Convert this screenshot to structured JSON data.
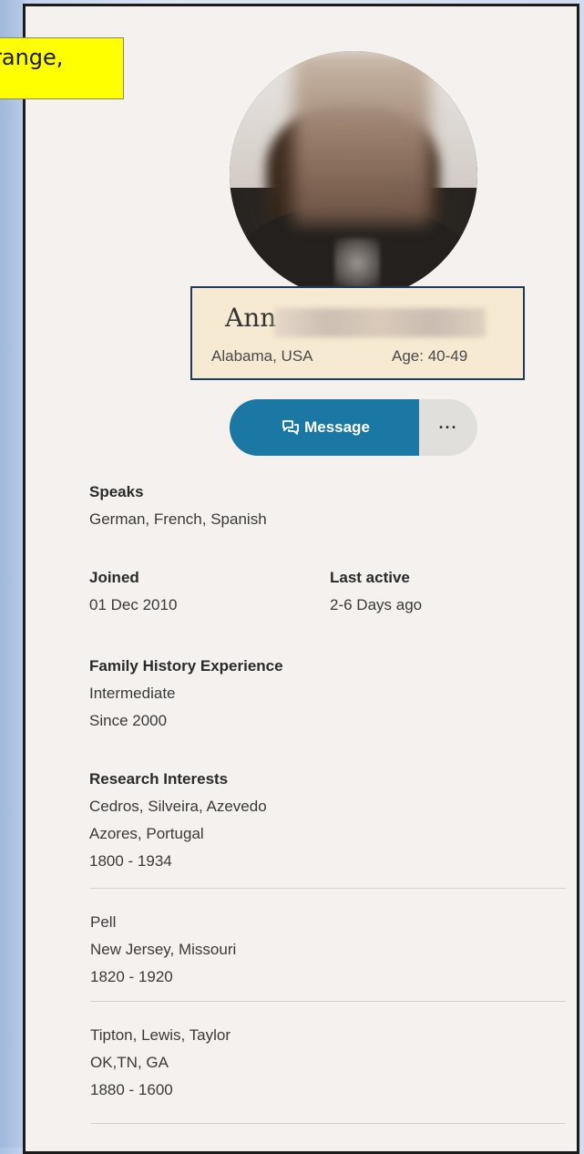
{
  "callout": {
    "text": "range,"
  },
  "profile": {
    "name_visible": "Ann",
    "location": "Alabama, USA",
    "age": "Age: 40-49"
  },
  "actions": {
    "message_label": "Message",
    "more_label": "···"
  },
  "speaks": {
    "label": "Speaks",
    "value": "German, French, Spanish"
  },
  "joined": {
    "label": "Joined",
    "value": "01 Dec 2010"
  },
  "last_active": {
    "label": "Last active",
    "value": "2-6 Days ago"
  },
  "experience": {
    "label": "Family History Experience",
    "level": "Intermediate",
    "since": "Since 2000"
  },
  "research": {
    "label": "Research Interests",
    "items": [
      {
        "surnames": "Cedros, Silveira, Azevedo",
        "places": "Azores, Portugal",
        "years": "1800 - 1934"
      },
      {
        "surnames": "Pell",
        "places": "New Jersey, Missouri",
        "years": "1820 - 1920"
      },
      {
        "surnames": "Tipton, Lewis, Taylor",
        "places": "OK,TN, GA",
        "years": "1880 - 1600"
      }
    ]
  },
  "colors": {
    "message_button": "#1b77a3",
    "more_button": "#e1dfdb",
    "card_background": "#f4f1ee",
    "callout_background": "#ffff00",
    "name_highlight": "#f7ead2"
  }
}
